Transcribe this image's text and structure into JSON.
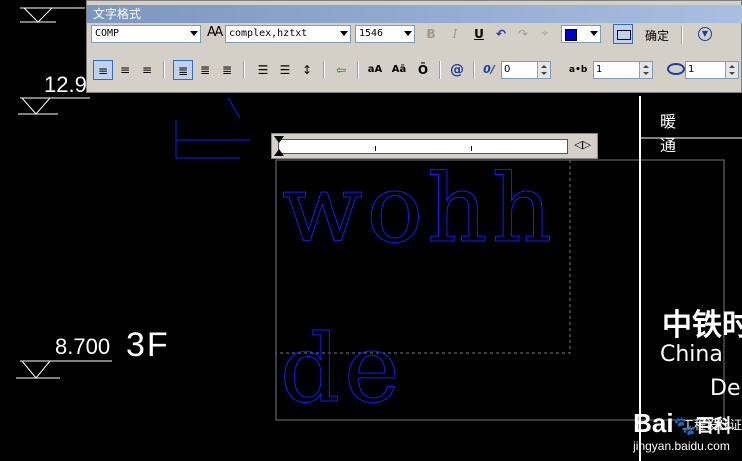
{
  "toolbar": {
    "title": "文字格式",
    "style_select": "COMP",
    "font_select": "complex,hztxt",
    "height_select": "1546",
    "ok_label": "确定",
    "oblique_value": "0",
    "tracking_value": "1",
    "width_value": "1",
    "buttons": {
      "bold": "B",
      "italic": "I",
      "underline": "U",
      "undo": "↶",
      "redo": "↷",
      "stack": "÷",
      "uppercase": "aA",
      "lowercase": "Aā",
      "overline": "Ō",
      "symbol": "@",
      "oblique": "0/",
      "tracking": "a•b"
    },
    "color_swatch": "#0000cc"
  },
  "drawing": {
    "level_1": "12.9",
    "level_2": "8.700",
    "floor_label": "3F",
    "mtext_line1": "wohh",
    "mtext_line2": "de",
    "right_header": "暖　通",
    "company_cn": "中铁时",
    "company_en": "China",
    "company_en2": "De",
    "subtitle": "工程设计证"
  },
  "watermark": {
    "brand": "Bai",
    "brand2": "百科",
    "url": "jingyan.baidu.com"
  },
  "colors": {
    "toolbar_bg": "#d4d0c8",
    "cad_bg": "#000000",
    "mtext_color": "#1a1aff",
    "title_bar": "#7b96c0"
  }
}
